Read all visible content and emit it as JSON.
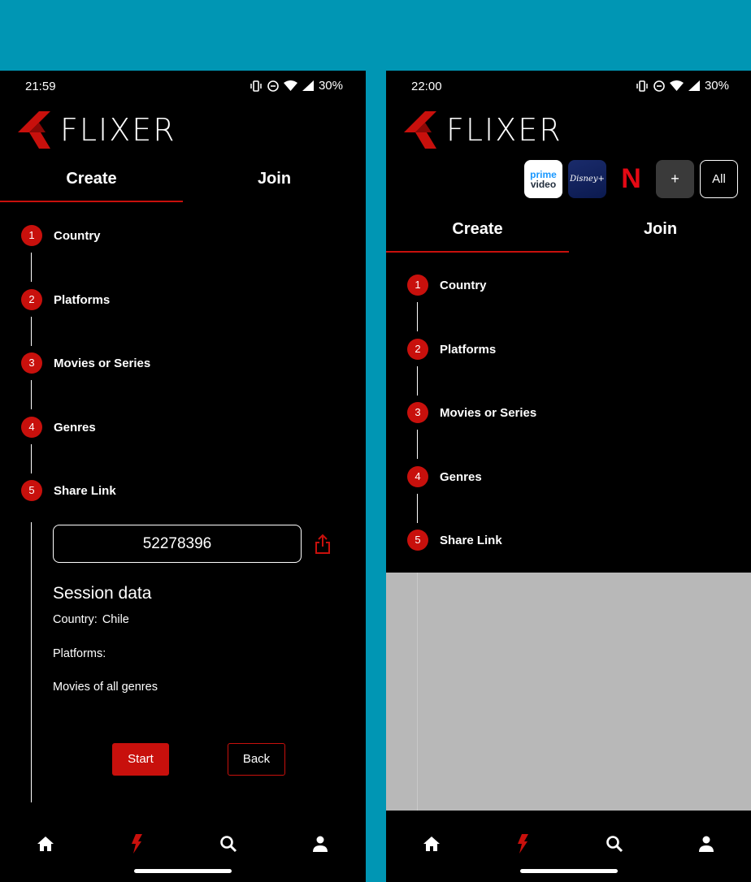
{
  "screens": [
    {
      "time": "21:59",
      "battery": "30%",
      "logo": "FLIXER",
      "tabs": [
        {
          "label": "Create"
        },
        {
          "label": "Join"
        }
      ],
      "steps": [
        {
          "num": "1",
          "label": "Country"
        },
        {
          "num": "2",
          "label": "Platforms"
        },
        {
          "num": "3",
          "label": "Movies or Series"
        },
        {
          "num": "4",
          "label": "Genres"
        },
        {
          "num": "5",
          "label": "Share Link"
        }
      ],
      "share": {
        "code": "52278396",
        "session_title": "Session data",
        "country_label": "Country:",
        "country_value": "Chile",
        "platforms_label": "Platforms:",
        "content_text": "Movies of all genres",
        "start_label": "Start",
        "back_label": "Back"
      }
    },
    {
      "time": "22:00",
      "battery": "30%",
      "logo": "FLIXER",
      "platforms": [
        {
          "name": "prime-video",
          "line1": "prime",
          "line2": "video"
        },
        {
          "name": "disney-plus",
          "label": "Disney+"
        },
        {
          "name": "netflix",
          "label": "N"
        },
        {
          "name": "add",
          "label": "+"
        },
        {
          "name": "all",
          "label": "All"
        }
      ],
      "tabs": [
        {
          "label": "Create"
        },
        {
          "label": "Join"
        }
      ],
      "steps": [
        {
          "num": "1",
          "label": "Country"
        },
        {
          "num": "2",
          "label": "Platforms"
        },
        {
          "num": "3",
          "label": "Movies or Series"
        },
        {
          "num": "4",
          "label": "Genres"
        },
        {
          "num": "5",
          "label": "Share Link"
        }
      ]
    }
  ],
  "nav_icons": [
    "home-icon",
    "flash-icon",
    "search-icon",
    "person-icon"
  ],
  "colors": {
    "accent": "#c8100c",
    "background": "#000000",
    "frame": "#0096b4",
    "panel": "#b8b8b8"
  }
}
